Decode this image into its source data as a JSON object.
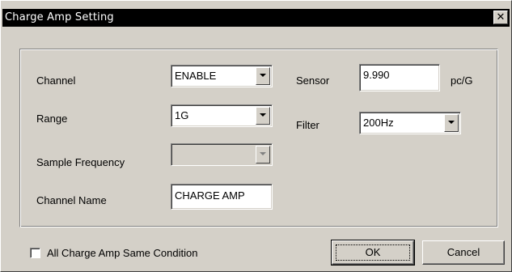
{
  "window": {
    "title": "Charge Amp Setting",
    "close_glyph": "✕"
  },
  "fields": {
    "channel": {
      "label": "Channel",
      "value": "ENABLE"
    },
    "range": {
      "label": "Range",
      "value": "1G"
    },
    "sample_frequency": {
      "label": "Sample Frequency",
      "value": ""
    },
    "channel_name": {
      "label": "Channel Name",
      "value": "CHARGE AMP"
    },
    "sensor": {
      "label": "Sensor",
      "value": "9.990",
      "unit": "pc/G"
    },
    "filter": {
      "label": "Filter",
      "value": "200Hz"
    }
  },
  "same_condition": {
    "label": "All Charge Amp Same Condition",
    "checked": false
  },
  "buttons": {
    "ok": "OK",
    "cancel": "Cancel"
  }
}
